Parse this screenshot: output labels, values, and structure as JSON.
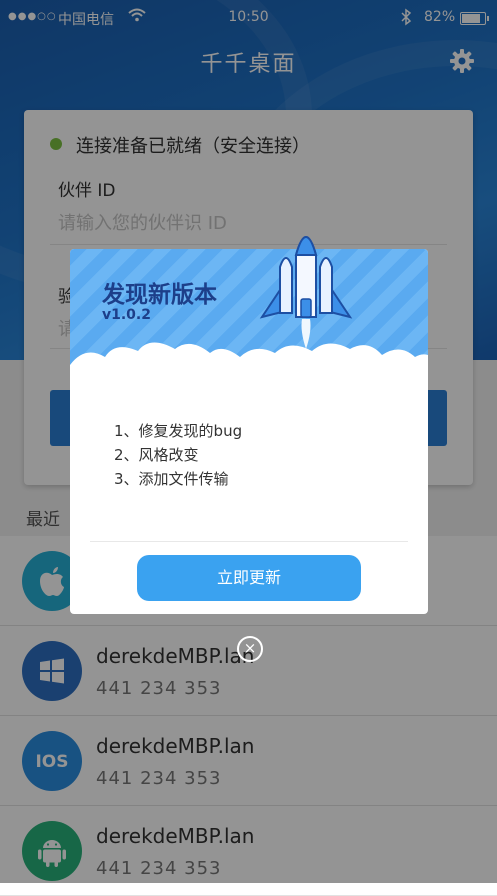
{
  "status_bar": {
    "signal": "●●●○○",
    "carrier": "中国电信",
    "time": "10:50",
    "battery": "82%",
    "battery_level": 0.82
  },
  "header": {
    "title": "千千桌面",
    "settings_icon": "gear-icon"
  },
  "connection_card": {
    "status_text": "连接准备已就绪（安全连接）",
    "status_color": "#7dc243",
    "partner_id_label": "伙伴 ID",
    "partner_id_placeholder": "请输入您的伙伴识 ID",
    "second_label": "验",
    "second_placeholder": "请"
  },
  "recent": {
    "label": "最近",
    "items": [
      {
        "name": "",
        "id": "",
        "icon": "apple-icon",
        "color": "#26b0d6"
      },
      {
        "name": "derekdeMBP.lan",
        "id": "441 234 353",
        "icon": "windows-icon",
        "color": "#2d6fc2"
      },
      {
        "name": "derekdeMBP.lan",
        "id": "441 234 353",
        "icon": "ios-icon",
        "color": "#2a8ee0"
      },
      {
        "name": "derekdeMBP.lan",
        "id": "441 234 353",
        "icon": "android-icon",
        "color": "#29b27a"
      }
    ]
  },
  "update_dialog": {
    "title": "发现新版本",
    "version": "v1.0.2",
    "notes": [
      "1、修复发现的bug",
      "2、风格改变",
      "3、添加文件传输"
    ],
    "button_label": "立即更新",
    "close_glyph": "×",
    "accent": "#3aa2f0"
  }
}
